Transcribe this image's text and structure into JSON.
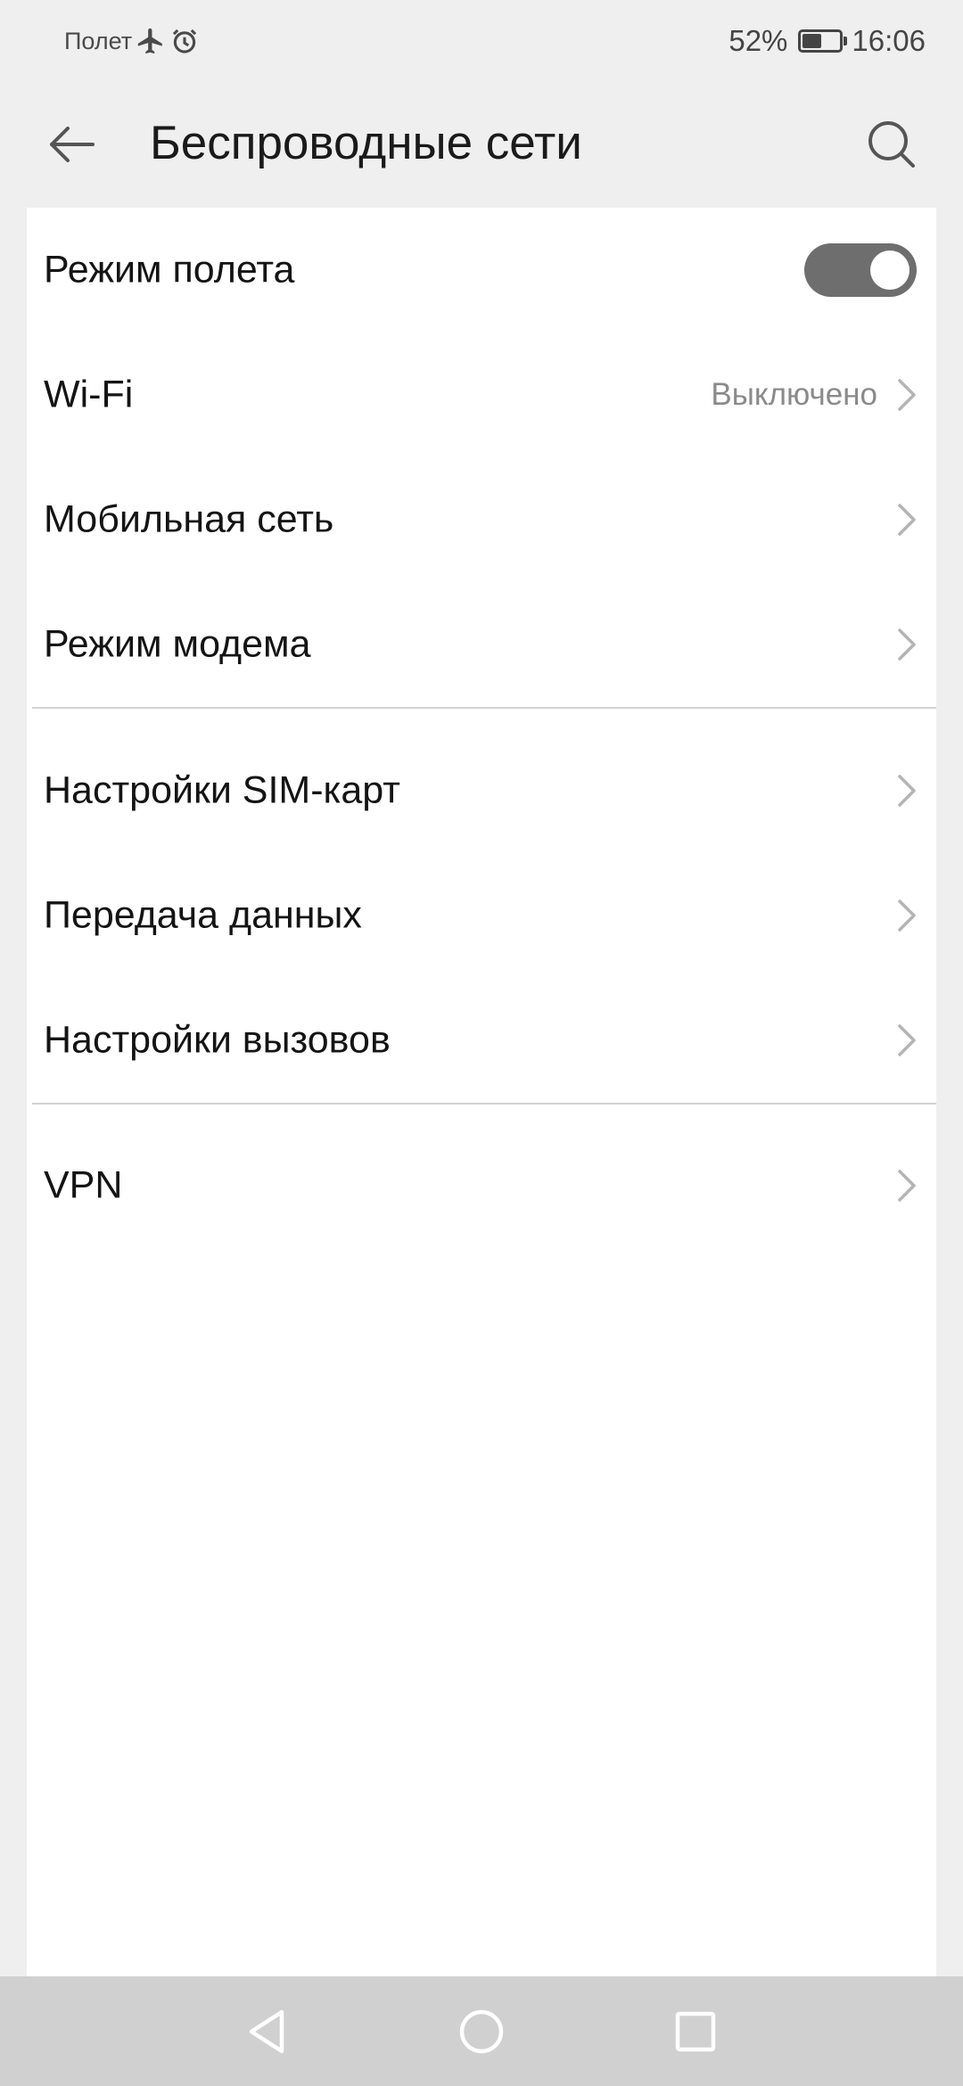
{
  "status_bar": {
    "carrier_text": "Полет",
    "airplane_icon": "airplane-icon",
    "alarm_icon": "alarm-icon",
    "battery_percent_text": "52%",
    "battery_level": 0.52,
    "time": "16:06"
  },
  "header": {
    "title": "Беспроводные сети",
    "back_icon": "arrow-left-icon",
    "search_icon": "search-icon"
  },
  "settings": {
    "airplane_mode": {
      "label": "Режим полета",
      "enabled": true
    },
    "wifi": {
      "label": "Wi-Fi",
      "value": "Выключено"
    },
    "mobile_network": {
      "label": "Мобильная сеть"
    },
    "tethering": {
      "label": "Режим модема"
    },
    "sim_settings": {
      "label": "Настройки SIM-карт"
    },
    "data_transfer": {
      "label": "Передача данных"
    },
    "call_settings": {
      "label": "Настройки вызовов"
    },
    "vpn": {
      "label": "VPN"
    }
  },
  "nav_bar": {
    "back_icon": "triangle-back-icon",
    "home_icon": "circle-home-icon",
    "recents_icon": "square-recents-icon"
  },
  "colors": {
    "background": "#efefef",
    "card": "#ffffff",
    "toggle_on": "#6e6e6e",
    "nav_bar": "#d0d0d0",
    "secondary_text": "#8a8a8a"
  }
}
